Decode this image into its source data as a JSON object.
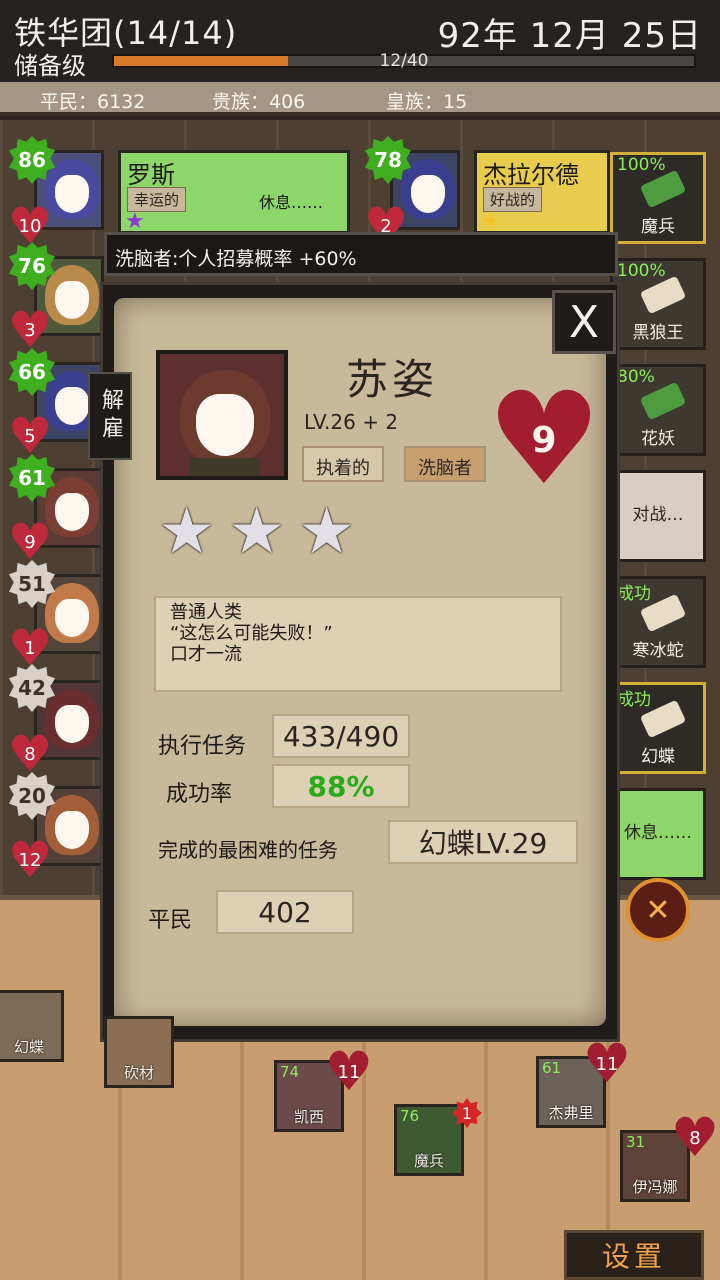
{
  "header": {
    "guild_name": "铁华团(14/14)",
    "guild_rank": "储备级",
    "date": "92年 12月 25日",
    "xp_text": "12/40",
    "xp_fraction": 0.3
  },
  "population": {
    "commoners": "平民：6132",
    "nobles": "贵族：406",
    "royals": "皇族：15"
  },
  "members_left": [
    {
      "level": "86",
      "hearts": "10"
    },
    {
      "level": "76",
      "hearts": "3"
    },
    {
      "level": "66",
      "hearts": "5"
    },
    {
      "level": "61",
      "hearts": "9"
    },
    {
      "level": "51",
      "hearts": "1"
    },
    {
      "level": "42",
      "hearts": "8"
    },
    {
      "level": "20",
      "hearts": "12"
    }
  ],
  "cards": [
    {
      "name": "罗斯",
      "trait": "幸运的",
      "status": "休息……",
      "level": "86"
    },
    {
      "name": "杰拉尔德",
      "trait": "好战的",
      "level": "78",
      "hearts": "2"
    }
  ],
  "missions": [
    {
      "pct": "100%",
      "name": "魔兵"
    },
    {
      "pct": "100%",
      "name": "黑狼王"
    },
    {
      "pct": "80%",
      "name": "花妖"
    },
    {
      "pct": "",
      "name": "对战…"
    },
    {
      "pct": "成功",
      "name": "寒冰蛇"
    },
    {
      "pct": "成功",
      "name": "幻蝶"
    },
    {
      "pct": "",
      "name": "休息……"
    }
  ],
  "buff_tooltip": "洗脑者:个人招募概率 +60%",
  "detail": {
    "dismiss_label": "解雇",
    "close_label": "X",
    "name": "苏姿",
    "level": "LV.26 + 2",
    "traits": [
      "执着的",
      "洗脑者"
    ],
    "hearts": "9",
    "star_count": 3,
    "bio": [
      "普通人类",
      "“这怎么可能失败！”",
      "口才一流"
    ],
    "missions_label": "执行任务",
    "missions_value": "433/490",
    "success_label": "成功率",
    "success_value": "88%",
    "hardest_label": "完成的最困难的任务",
    "hardest_value": "幻蝶LV.29",
    "class_label": "平民",
    "class_value": "402"
  },
  "floor_items": [
    {
      "name": "幻蝶",
      "level": ""
    },
    {
      "name": "砍材",
      "level": ""
    },
    {
      "name": "凯西",
      "level": "74",
      "hearts": "11"
    },
    {
      "name": "魔兵",
      "level": "76",
      "alert": "1"
    },
    {
      "name": "杰弗里",
      "level": "61",
      "hearts": "11"
    },
    {
      "name": "伊冯娜",
      "level": "31",
      "hearts": "8"
    }
  ],
  "settings_label": "设置",
  "colors": {
    "accent_green": "#3fae1f",
    "heart_red": "#c0283b",
    "xp_orange": "#d67a2a",
    "success_green": "#2aa91a"
  }
}
